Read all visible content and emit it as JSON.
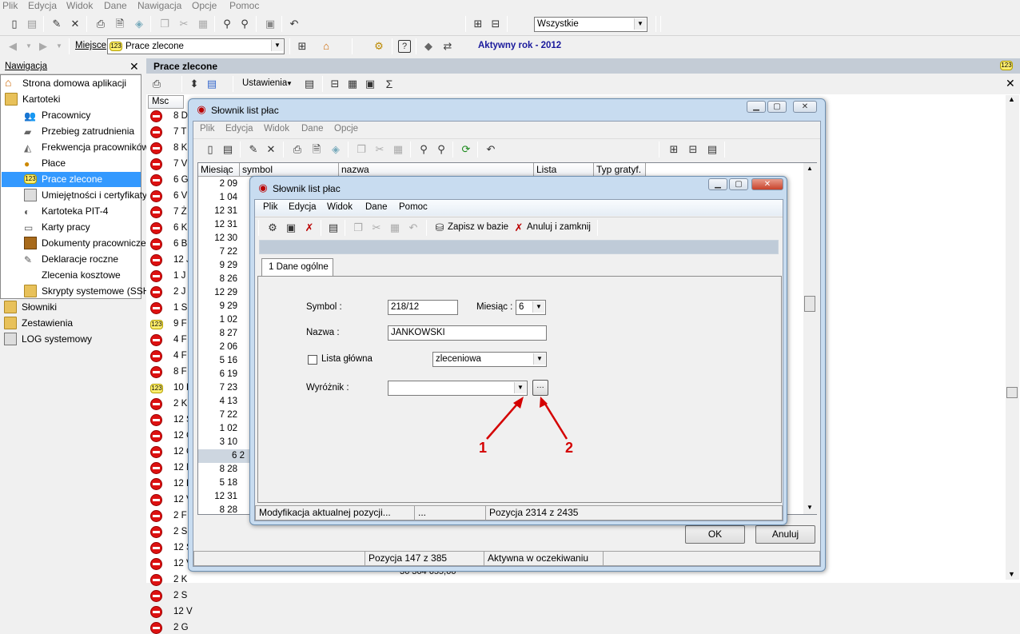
{
  "menubar": {
    "items": [
      "Plik",
      "Edycja",
      "Widok",
      "Dane",
      "Nawigacja",
      "Opcje",
      "Pomoc"
    ]
  },
  "filter": {
    "value": "Wszystkie"
  },
  "addressbar": {
    "place_label": "Miejsce",
    "place_value": "Prace zlecone",
    "year_label": "Aktywny rok - 2012"
  },
  "nav": {
    "title": "Nawigacja",
    "items": [
      "Strona domowa aplikacji",
      "Kartoteki",
      "Pracownicy",
      "Przebieg zatrudnienia",
      "Frekwencja pracowników",
      "Płace",
      "Prace zlecone",
      "Umiejętności i certyfikaty",
      "Kartoteka PIT-4",
      "Karty pracy",
      "Dokumenty pracownicze",
      "Deklaracje roczne",
      "Zlecenia kosztowe",
      "Skrypty systemowe (SSH)",
      "Słowniki",
      "Zestawienia",
      "LOG systemowy"
    ]
  },
  "main": {
    "title": "Prace zlecone",
    "settings_label": "Ustawienia",
    "col_msc": "Msc",
    "rows": [
      "8 D",
      "7 T",
      "8 K",
      "7 V",
      "6 G",
      "6 V",
      "7 Ż",
      "6 K",
      "6 B",
      "12 J",
      "1 J",
      "2 J",
      "1 S",
      "9 F",
      "4 F",
      "4 F",
      "8 F",
      "10 F",
      "2 K",
      "12 S",
      "12 G",
      "12 C",
      "12 M",
      "12 B",
      "12 V",
      "2 F",
      "2 S",
      "12 S",
      "12 V",
      "2 K",
      "2 S",
      "12 V",
      "2 G"
    ],
    "bottom_value": "36 364 655,66"
  },
  "outer_window": {
    "title": "Słownik list płac",
    "menu": [
      "Plik",
      "Edycja",
      "Widok",
      "Dane",
      "Opcje"
    ],
    "columns": [
      "Miesiąc",
      "symbol",
      "nazwa",
      "Lista główna?",
      "Typ gratyf."
    ],
    "months": [
      "2 09",
      "1 04",
      "12 31",
      "12 31",
      "12 30",
      "7 22",
      "9 29",
      "8 26",
      "12 29",
      "9 29",
      "1 02",
      "8 27",
      "2 06",
      "5 16",
      "6 19",
      "7 23",
      "4 13",
      "7 22",
      "1 02",
      "3 10",
      "6 2",
      "8 28",
      "5 18",
      "12 31",
      "8 28"
    ],
    "ok_label": "OK",
    "cancel_label": "Anuluj",
    "status_position": "Pozycja 147 z 385",
    "status_state": "Aktywna w oczekiwaniu"
  },
  "inner_window": {
    "title": "Słownik list płac",
    "menu": [
      "Plik",
      "Edycja",
      "Widok",
      "Dane",
      "Pomoc"
    ],
    "save_label": "Zapisz w bazie",
    "cancel_close_label": "Anuluj i zamknij",
    "tab_label": "1 Dane ogólne",
    "symbol_label": "Symbol :",
    "symbol_value": "218/12",
    "month_label": "Miesiąc :",
    "month_value": "6",
    "name_label": "Nazwa :",
    "name_value": "JANKOWSKI",
    "main_list_label": "Lista główna",
    "type_value": "zleceniowa",
    "marker_label": "Wyróżnik :",
    "marker_value": "",
    "annotation_1": "1",
    "annotation_2": "2",
    "status_mode": "Modyfikacja aktualnej pozycji...",
    "status_dots": "...",
    "status_position": "Pozycja 2314 z 2435"
  },
  "icons": {
    "accent": "#d11111",
    "annotation_color": "#d40000",
    "title_blue": "#1a1a9c"
  }
}
